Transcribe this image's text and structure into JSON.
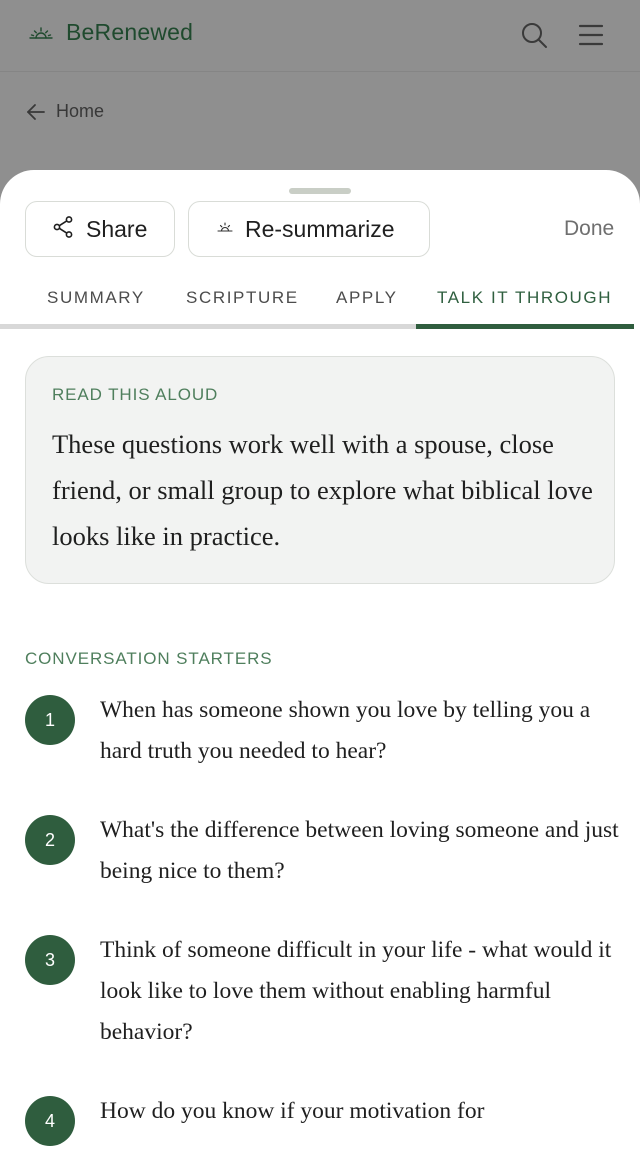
{
  "app": {
    "brand_name": "BeRenewed"
  },
  "background": {
    "back_label": "Home"
  },
  "sheet": {
    "share_label": "Share",
    "resummarize_label": "Re-summarize",
    "done_label": "Done",
    "tabs": [
      {
        "label": "SUMMARY",
        "active": false
      },
      {
        "label": "SCRIPTURE",
        "active": false
      },
      {
        "label": "APPLY",
        "active": false
      },
      {
        "label": "TALK IT THROUGH",
        "active": true
      }
    ],
    "read_aloud": {
      "label": "READ THIS ALOUD",
      "text": "These questions work well with a spouse, close friend, or small group to explore what biblical love looks like in practice."
    },
    "starters": {
      "heading": "CONVERSATION STARTERS",
      "items": [
        {
          "number": "1",
          "text": "When has someone shown you love by telling you a hard truth you needed to hear?"
        },
        {
          "number": "2",
          "text": "What's the difference between loving someone and just being nice to them?"
        },
        {
          "number": "3",
          "text": "Think of someone difficult in your life - what would it look like to love them without enabling harmful behavior?"
        },
        {
          "number": "4",
          "text": "How do you know if your motivation for"
        }
      ]
    }
  },
  "colors": {
    "accent": "#2f5d3e",
    "accent_text": "#4f7f5d",
    "overlay": "#8f8f8f",
    "card_bg": "#f2f3f2"
  },
  "icons": {
    "brand": "sunrise-icon",
    "search": "search-icon",
    "menu": "hamburger-menu-icon",
    "back": "arrow-left-icon",
    "share": "share-icon",
    "resummarize": "sunrise-icon"
  }
}
